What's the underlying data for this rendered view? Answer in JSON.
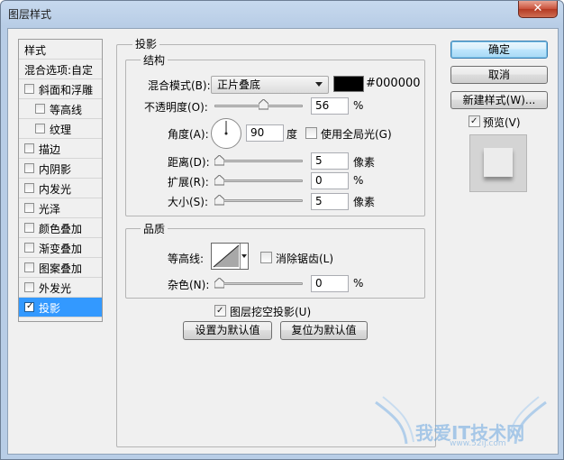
{
  "window": {
    "title": "图层样式",
    "close_glyph": "✕"
  },
  "style_list": {
    "items": [
      {
        "label": "样式",
        "checkbox": false,
        "indent": 0,
        "selected": false
      },
      {
        "label": "混合选项:自定",
        "checkbox": false,
        "indent": 0,
        "selected": false
      },
      {
        "label": "斜面和浮雕",
        "checkbox": true,
        "checked": false,
        "indent": 0,
        "selected": false
      },
      {
        "label": "等高线",
        "checkbox": true,
        "checked": false,
        "indent": 1,
        "selected": false
      },
      {
        "label": "纹理",
        "checkbox": true,
        "checked": false,
        "indent": 1,
        "selected": false
      },
      {
        "label": "描边",
        "checkbox": true,
        "checked": false,
        "indent": 0,
        "selected": false
      },
      {
        "label": "内阴影",
        "checkbox": true,
        "checked": false,
        "indent": 0,
        "selected": false
      },
      {
        "label": "内发光",
        "checkbox": true,
        "checked": false,
        "indent": 0,
        "selected": false
      },
      {
        "label": "光泽",
        "checkbox": true,
        "checked": false,
        "indent": 0,
        "selected": false
      },
      {
        "label": "颜色叠加",
        "checkbox": true,
        "checked": false,
        "indent": 0,
        "selected": false
      },
      {
        "label": "渐变叠加",
        "checkbox": true,
        "checked": false,
        "indent": 0,
        "selected": false
      },
      {
        "label": "图案叠加",
        "checkbox": true,
        "checked": false,
        "indent": 0,
        "selected": false
      },
      {
        "label": "外发光",
        "checkbox": true,
        "checked": false,
        "indent": 0,
        "selected": false
      },
      {
        "label": "投影",
        "checkbox": true,
        "checked": true,
        "indent": 0,
        "selected": true
      }
    ]
  },
  "drop_shadow": {
    "title": "投影",
    "structure": {
      "title": "结构",
      "blend_mode_label": "混合模式(B):",
      "blend_mode_value": "正片叠底",
      "color_hex": "#000000",
      "opacity_label": "不透明度(O):",
      "opacity_value": "56",
      "opacity_unit": "%",
      "angle_label": "角度(A):",
      "angle_value": "90",
      "angle_unit": "度",
      "global_light_label": "使用全局光(G)",
      "global_light_checked": false,
      "distance_label": "距离(D):",
      "distance_value": "5",
      "distance_unit": "像素",
      "spread_label": "扩展(R):",
      "spread_value": "0",
      "spread_unit": "%",
      "size_label": "大小(S):",
      "size_value": "5",
      "size_unit": "像素"
    },
    "quality": {
      "title": "品质",
      "contour_label": "等高线:",
      "anti_alias_label": "消除锯齿(L)",
      "anti_alias_checked": false,
      "noise_label": "杂色(N):",
      "noise_value": "0",
      "noise_unit": "%"
    },
    "knockout_label": "图层挖空投影(U)",
    "knockout_checked": true,
    "make_default_label": "设置为默认值",
    "reset_default_label": "复位为默认值"
  },
  "buttons": {
    "ok": "确定",
    "cancel": "取消",
    "new_style": "新建样式(W)..."
  },
  "preview": {
    "label": "预览(V)",
    "checked": true
  },
  "watermark": {
    "text": "我爱IT技术网",
    "url": "www.52ij.com"
  },
  "colors": {
    "selection": "#3399ff",
    "shadow_color": "#000000",
    "title_bar": "#b8cde6"
  }
}
